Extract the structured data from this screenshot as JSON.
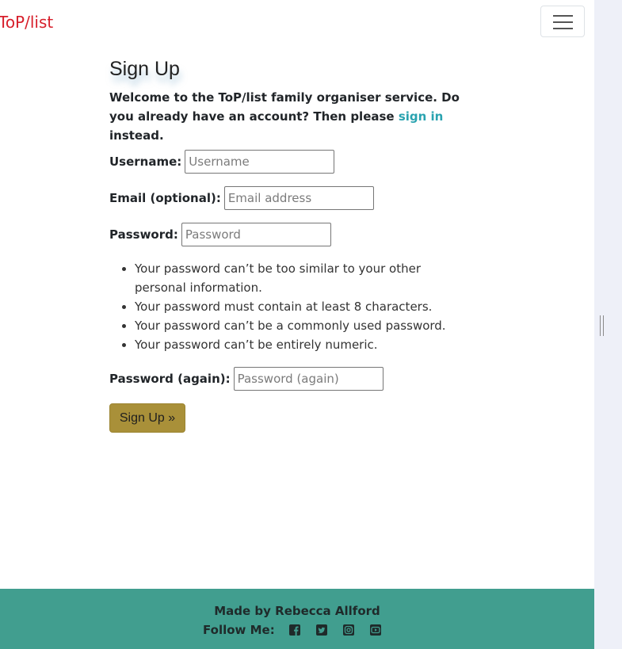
{
  "nav": {
    "brand": "ToP/list",
    "toggler_icon": "menu-icon"
  },
  "main": {
    "title": "Sign Up",
    "welcome_text": "Welcome to the ToP/list family organiser service. Do you already have an account? Then please ",
    "signin_link": "sign in",
    "welcome_suffix": " instead."
  },
  "form": {
    "username_label": "Username:",
    "username_placeholder": "Username",
    "email_label": "Email (optional):",
    "email_placeholder": "Email address",
    "password_label": "Password:",
    "password_placeholder": "Password",
    "password_help": [
      "Your password can’t be too similar to your other personal information.",
      "Your password must contain at least 8 characters.",
      "Your password can’t be a commonly used password.",
      "Your password can’t be entirely numeric."
    ],
    "password2_label": "Password (again):",
    "password2_placeholder": "Password (again)",
    "submit_label": "Sign Up »"
  },
  "footer": {
    "made_by": "Made by Rebecca Allford",
    "follow_label": "Follow Me:",
    "social_icons": [
      "facebook-icon",
      "twitter-icon",
      "instagram-icon",
      "youtube-icon"
    ]
  },
  "colors": {
    "brand": "#d71f2b",
    "link": "#2aa3b0",
    "button": "#a99039",
    "footer": "#419e8f"
  }
}
